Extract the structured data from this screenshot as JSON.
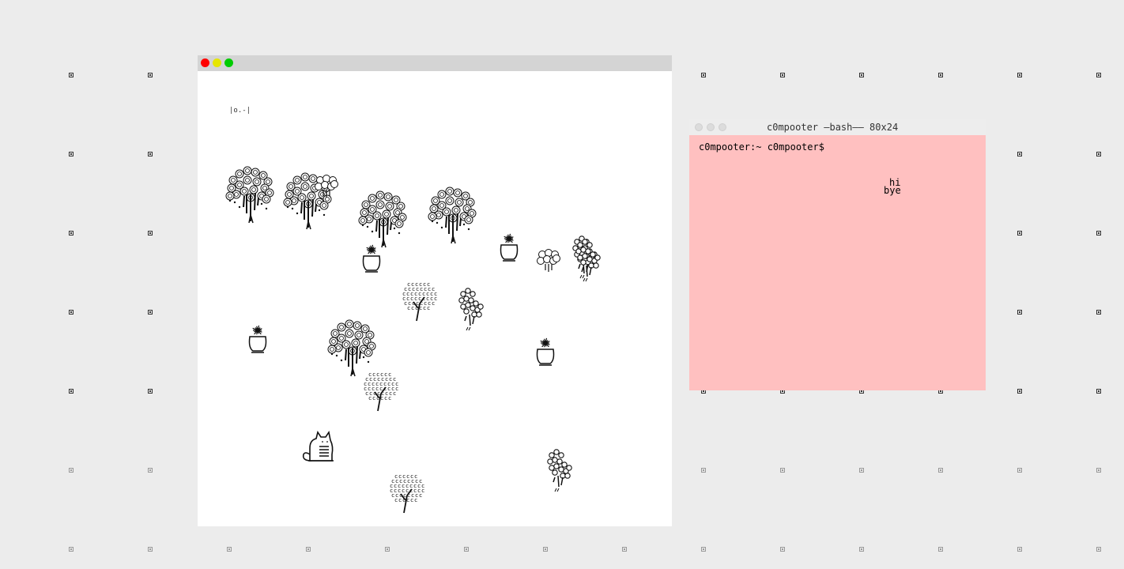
{
  "desktop": {
    "background": "#ececec"
  },
  "game_window": {
    "traffic_lights": [
      {
        "name": "close",
        "color": "#ff0000"
      },
      {
        "name": "minimize",
        "color": "#e6e600"
      },
      {
        "name": "zoom",
        "color": "#00cc00"
      }
    ],
    "mini_label": "|o.-|",
    "sprites": [
      {
        "kind": "swirl-tree"
      },
      {
        "kind": "swirl-tree"
      },
      {
        "kind": "swirl-tree"
      },
      {
        "kind": "swirl-tree"
      },
      {
        "kind": "swirl-tree"
      },
      {
        "kind": "puff-tree"
      },
      {
        "kind": "puff-tree"
      },
      {
        "kind": "bubble-tree"
      },
      {
        "kind": "bubble-tree"
      },
      {
        "kind": "bubble-tree"
      },
      {
        "kind": "bubble-tree"
      },
      {
        "kind": "leaf-tree"
      },
      {
        "kind": "leaf-tree"
      },
      {
        "kind": "leaf-tree"
      },
      {
        "kind": "potted-plant"
      },
      {
        "kind": "potted-plant"
      },
      {
        "kind": "potted-plant"
      },
      {
        "kind": "potted-plant"
      },
      {
        "kind": "cat"
      }
    ]
  },
  "terminal": {
    "title": "c0mpooter —bash—— 80x24",
    "prompt": "c0mpooter:~ c0mpooter$",
    "output_hi": "hi",
    "output_bye": "bye",
    "background": "#ffc0c0"
  }
}
